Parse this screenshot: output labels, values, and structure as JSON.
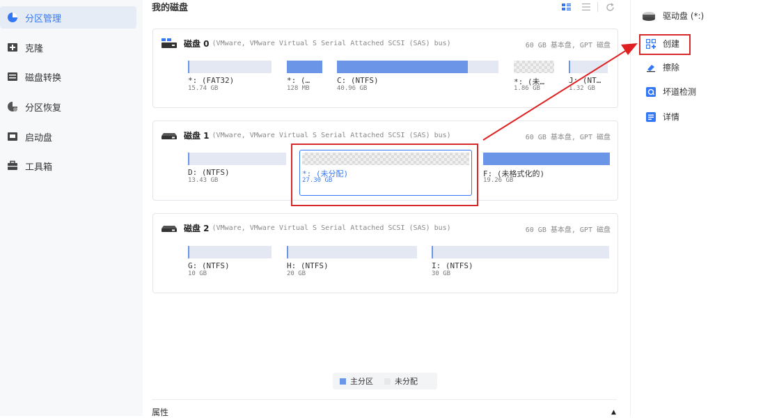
{
  "sidebar": {
    "items": [
      {
        "label": "分区管理",
        "icon": "pie-chart-icon",
        "active": true
      },
      {
        "label": "克隆",
        "icon": "clone-icon"
      },
      {
        "label": "磁盘转换",
        "icon": "disk-convert-icon"
      },
      {
        "label": "分区恢复",
        "icon": "partition-recovery-icon"
      },
      {
        "label": "启动盘",
        "icon": "bootable-disk-icon"
      },
      {
        "label": "工具箱",
        "icon": "toolbox-icon"
      }
    ]
  },
  "main": {
    "title": "我的磁盘",
    "toolbar": {
      "grid_icon": "grid-view-icon",
      "list_icon": "list-view-icon",
      "refresh_icon": "refresh-icon"
    }
  },
  "disks": [
    {
      "name": "磁盘 0",
      "desc": "(VMware,  VMware Virtual S Serial Attached SCSI (SAS) bus)",
      "info": "60 GB 基本盘, GPT 磁盘",
      "partitions": [
        {
          "label": "*: (FAT32)",
          "size": "15.74 GB"
        },
        {
          "label": "*: (…",
          "size": "128 MB"
        },
        {
          "label": "C: (NTFS)",
          "size": "40.96 GB"
        },
        {
          "label": "*: (未…",
          "size": "1.86 GB"
        },
        {
          "label": "J: (NT…",
          "size": "1.32 GB"
        }
      ]
    },
    {
      "name": "磁盘 1",
      "desc": "(VMware,  VMware Virtual S Serial Attached SCSI (SAS) bus)",
      "info": "60 GB 基本盘, GPT 磁盘",
      "partitions": [
        {
          "label": "D: (NTFS)",
          "size": "13.43 GB"
        },
        {
          "label": "*: (未分配)",
          "size": "27.30 GB"
        },
        {
          "label": "F: (未格式化的)",
          "size": "19.26 GB"
        }
      ]
    },
    {
      "name": "磁盘 2",
      "desc": "(VMware,  VMware Virtual S Serial Attached SCSI (SAS) bus)",
      "info": "60 GB 基本盘, GPT 磁盘",
      "partitions": [
        {
          "label": "G: (NTFS)",
          "size": "10 GB"
        },
        {
          "label": "H: (NTFS)",
          "size": "20 GB"
        },
        {
          "label": "I: (NTFS)",
          "size": "30 GB"
        }
      ]
    }
  ],
  "legend": {
    "primary": "主分区",
    "unallocated": "未分配"
  },
  "properties": {
    "label": "属性",
    "toggle_icon": "▲"
  },
  "right_panel": {
    "drive": "驱动盘  (*:)",
    "actions": [
      {
        "label": "创建",
        "icon": "create-icon"
      },
      {
        "label": "擦除",
        "icon": "eraser-icon"
      },
      {
        "label": "坏道检测",
        "icon": "bad-sector-check-icon"
      },
      {
        "label": "详情",
        "icon": "details-icon"
      }
    ]
  },
  "colors": {
    "accent": "#3478f6",
    "partition_used": "#6b95e6",
    "highlight": "#d62828"
  }
}
